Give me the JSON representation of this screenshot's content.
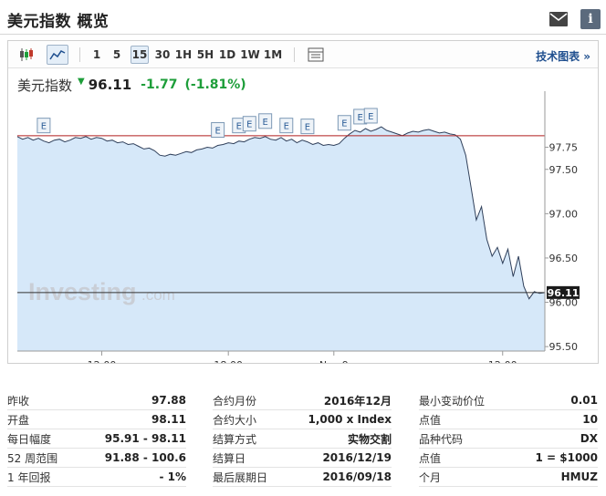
{
  "header": {
    "title": "美元指数 概览"
  },
  "toolbar": {
    "timeframes": [
      "1",
      "5",
      "15",
      "30",
      "1H",
      "5H",
      "1D",
      "1W",
      "1M"
    ],
    "active_timeframe": "15",
    "tech_link": "技术图表 »"
  },
  "quote": {
    "name": "美元指数",
    "price": "96.11",
    "change": "-1.77",
    "change_pct": "(-1.81%)",
    "up_color": "#1e9e3a"
  },
  "chart_data": {
    "type": "area",
    "x_tick_labels": [
      "12:00",
      "18:00",
      "Nov 9",
      "12:00"
    ],
    "x_tick_positions": [
      16,
      40,
      60,
      92
    ],
    "y_ticks": [
      97.75,
      97.5,
      97.0,
      96.5,
      96.0,
      95.5
    ],
    "y_tick_labels": [
      "97.75",
      "97.50",
      "97.00",
      "96.50",
      "96.00",
      "95.50"
    ],
    "ylim": [
      95.45,
      98.3
    ],
    "x_max": 100,
    "previous_close": 97.88,
    "current_price": 96.11,
    "current_label": "96.11",
    "series": [
      {
        "x": [
          0,
          1,
          2,
          3,
          4,
          5,
          6,
          7,
          8,
          9,
          10,
          11,
          12,
          13,
          14,
          15,
          16,
          17,
          18,
          19,
          20,
          21,
          22,
          23,
          24,
          25,
          26,
          27,
          28,
          29,
          30,
          31,
          32,
          33,
          34,
          35,
          36,
          37,
          38,
          39,
          40,
          41,
          42,
          43,
          44,
          45,
          46,
          47,
          48,
          49,
          50,
          51,
          52,
          53,
          54,
          55,
          56,
          57,
          58,
          59,
          60,
          61,
          62,
          63,
          64,
          65,
          66,
          67,
          68,
          69,
          70,
          71,
          72,
          73,
          74,
          75,
          76,
          77,
          78,
          79,
          80,
          81,
          82,
          83,
          84,
          85,
          86,
          87,
          88,
          89,
          90,
          91,
          92,
          93,
          94,
          95,
          96,
          97,
          98,
          99,
          100
        ],
        "values": [
          97.87,
          97.84,
          97.86,
          97.83,
          97.85,
          97.82,
          97.8,
          97.83,
          97.84,
          97.81,
          97.83,
          97.86,
          97.85,
          97.87,
          97.84,
          97.86,
          97.85,
          97.82,
          97.83,
          97.8,
          97.81,
          97.78,
          97.79,
          97.76,
          97.73,
          97.74,
          97.71,
          97.66,
          97.65,
          97.67,
          97.66,
          97.68,
          97.7,
          97.69,
          97.72,
          97.73,
          97.75,
          97.74,
          97.77,
          97.78,
          97.8,
          97.79,
          97.82,
          97.81,
          97.84,
          97.86,
          97.85,
          97.87,
          97.84,
          97.83,
          97.86,
          97.82,
          97.84,
          97.8,
          97.83,
          97.81,
          97.78,
          97.8,
          97.77,
          97.78,
          97.77,
          97.79,
          97.85,
          97.9,
          97.94,
          97.92,
          97.96,
          97.93,
          97.95,
          97.98,
          97.94,
          97.92,
          97.9,
          97.88,
          97.91,
          97.93,
          97.92,
          97.94,
          97.95,
          97.93,
          97.91,
          97.92,
          97.9,
          97.89,
          97.84,
          97.66,
          97.3,
          96.93,
          97.08,
          96.71,
          96.52,
          96.62,
          96.44,
          96.6,
          96.29,
          96.52,
          96.18,
          96.04,
          96.12,
          96.1,
          96.11
        ]
      }
    ],
    "event_markers": [
      {
        "x": 5,
        "label": "E"
      },
      {
        "x": 38,
        "label": "E"
      },
      {
        "x": 42,
        "label": "E"
      },
      {
        "x": 44,
        "label": "E"
      },
      {
        "x": 47,
        "label": "E"
      },
      {
        "x": 51,
        "label": "E"
      },
      {
        "x": 55,
        "label": "E"
      },
      {
        "x": 62,
        "label": "E"
      },
      {
        "x": 65,
        "label": "E"
      },
      {
        "x": 67,
        "label": "E"
      }
    ],
    "line_color": "#2f3f5a",
    "fill_color": "#d6e8f9",
    "prev_close_color": "#b11e1e",
    "grid": false
  },
  "watermark": {
    "brand": "Investing",
    "suffix": ".com"
  },
  "stats": {
    "col1": [
      {
        "label": "昨收",
        "value": "97.88"
      },
      {
        "label": "开盘",
        "value": "98.11"
      },
      {
        "label": "每日幅度",
        "value": "95.91 - 98.11"
      },
      {
        "label": "52 周范围",
        "value": "91.88 - 100.6"
      },
      {
        "label": "1 年回报",
        "value": "- 1%"
      }
    ],
    "col2": [
      {
        "label": "合约月份",
        "value": "2016年12月"
      },
      {
        "label": "合约大小",
        "value": "1,000 x Index"
      },
      {
        "label": "结算方式",
        "value": "实物交割"
      },
      {
        "label": "结算日",
        "value": "2016/12/19"
      },
      {
        "label": "最后展期日",
        "value": "2016/09/18"
      }
    ],
    "col3": [
      {
        "label": "最小变动价位",
        "value": "0.01"
      },
      {
        "label": "点值",
        "value": "10"
      },
      {
        "label": "品种代码",
        "value": "DX"
      },
      {
        "label": "点值",
        "value": "1 = $1000"
      },
      {
        "label": "个月",
        "value": "HMUZ"
      }
    ]
  }
}
